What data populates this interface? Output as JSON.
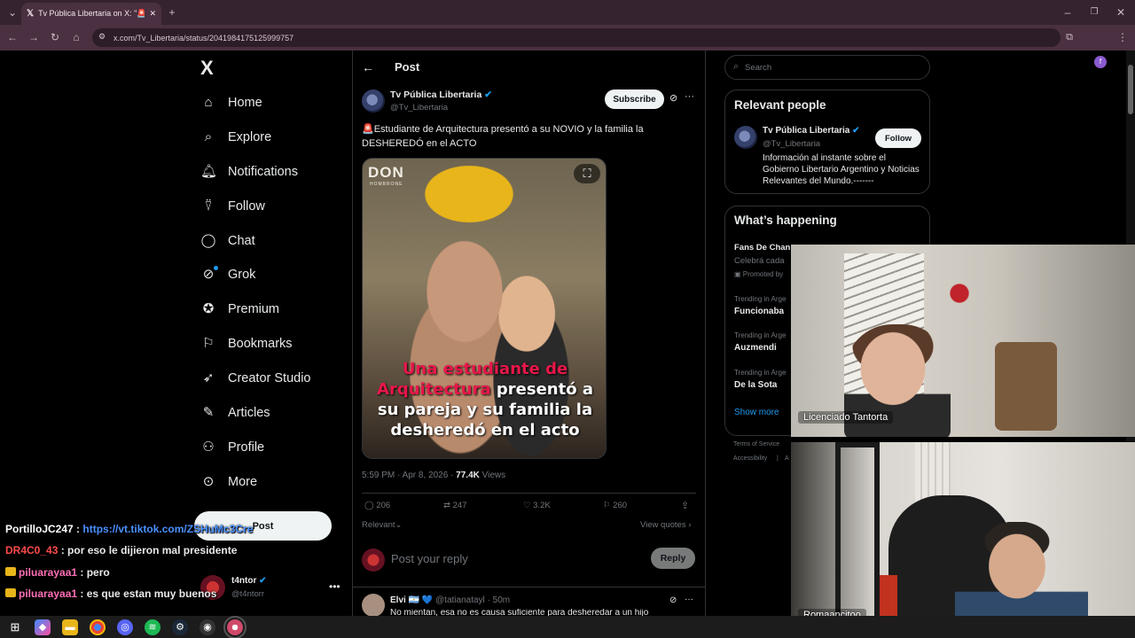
{
  "browser": {
    "tab_title": "Tv Pública Libertaria on X: \"🚨E",
    "url": "x.com/Tv_Libertaria/status/2041984175125999757"
  },
  "nav": {
    "logo": "X",
    "items": [
      {
        "label": "Home",
        "icon": "home-icon"
      },
      {
        "label": "Explore",
        "icon": "search-icon"
      },
      {
        "label": "Notifications",
        "icon": "bell-icon"
      },
      {
        "label": "Follow",
        "icon": "add-person-icon"
      },
      {
        "label": "Chat",
        "icon": "chat-icon"
      },
      {
        "label": "Grok",
        "icon": "grok-icon"
      },
      {
        "label": "Premium",
        "icon": "verified-icon"
      },
      {
        "label": "Bookmarks",
        "icon": "bookmark-icon"
      },
      {
        "label": "Creator Studio",
        "icon": "rocket-icon"
      },
      {
        "label": "Articles",
        "icon": "article-icon"
      },
      {
        "label": "Profile",
        "icon": "person-icon"
      },
      {
        "label": "More",
        "icon": "more-icon"
      }
    ],
    "post_button": "Post",
    "account": {
      "name": "t4ntor",
      "handle": "@t4ntorr"
    }
  },
  "post": {
    "header": "Post",
    "author_name": "Tv Pública Libertaria",
    "author_handle": "@Tv_Libertaria",
    "subscribe": "Subscribe",
    "text": "🚨Estudiante de Arquitectura presentó a su NOVIO y la familia la DESHEREDÓ en el ACTO",
    "image_brand": "DON",
    "image_brand_sub": "HOMBRONE",
    "image_caption_red1": "Una estudiante de",
    "image_caption_red2": "Arquitectura",
    "image_caption_white1": " presentó a",
    "image_caption_white2": "su pareja y su familia la",
    "image_caption_white3": "desheredó en el acto",
    "timestamp": "5:59 PM · Apr 8, 2026 · ",
    "views_count": "77.4K",
    "views_label": " Views",
    "stats": {
      "replies": "206",
      "reposts": "247",
      "likes": "3.2K",
      "bookmarks": "260"
    },
    "relevant": "Relevant",
    "view_quotes": "View quotes",
    "reply_placeholder": "Post your reply",
    "reply_button": "Reply",
    "comment": {
      "name": "Elvi 🇦🇷 💙",
      "handle": "@tatianatayl · 50m",
      "text": "No mientan, esa no es causa suficiente para desheredar a un hijo"
    }
  },
  "sidebar": {
    "search_placeholder": "Search",
    "relevant_title": "Relevant people",
    "person": {
      "name": "Tv Pública Libertaria",
      "handle": "@Tv_Libertaria",
      "follow": "Follow",
      "bio": "Información al instante sobre el Gobierno Libertario Argentino y Noticias Relevantes del Mundo.-------"
    },
    "happening_title": "What’s happening",
    "trends": [
      {
        "meta": "",
        "title": "Fans De Chan",
        "sub": "Celebrá cada",
        "promo": "Promoted by"
      },
      {
        "meta": "Trending in Arge",
        "title": "Funcionaba"
      },
      {
        "meta": "Trending in Arge",
        "title": "Auzmendi"
      },
      {
        "meta": "Trending in Arge",
        "title": "De la Sota"
      }
    ],
    "show_more": "Show more",
    "footer": [
      "Terms of Service",
      "Accessibility",
      "A"
    ]
  },
  "chat": [
    {
      "user": "PortilloJC247",
      "color": "#ffffff",
      "sep": " : ",
      "msg": "https://vt.tiktok.com/ZSHuMc3Cre",
      "link": true,
      "badge": false
    },
    {
      "user": "DR4C0_43",
      "color": "#ff4a4a",
      "sep": " : ",
      "msg": "por eso le dijieron mal presidente",
      "link": false,
      "badge": false
    },
    {
      "user": "piluarayaa1",
      "color": "#ff6fb5",
      "sep": " : ",
      "msg": "pero",
      "link": false,
      "badge": true
    },
    {
      "user": "piluarayaa1",
      "color": "#ff6fb5",
      "sep": " : ",
      "msg": "es que estan muy buenos",
      "link": false,
      "badge": true
    }
  ],
  "webcams": [
    {
      "label": "Licenciado Tantorta"
    },
    {
      "label": "Romaancitoo"
    }
  ],
  "colors": {
    "accent": "#1d9bf0",
    "bg": "#000000",
    "chrome": "#4a3040"
  }
}
